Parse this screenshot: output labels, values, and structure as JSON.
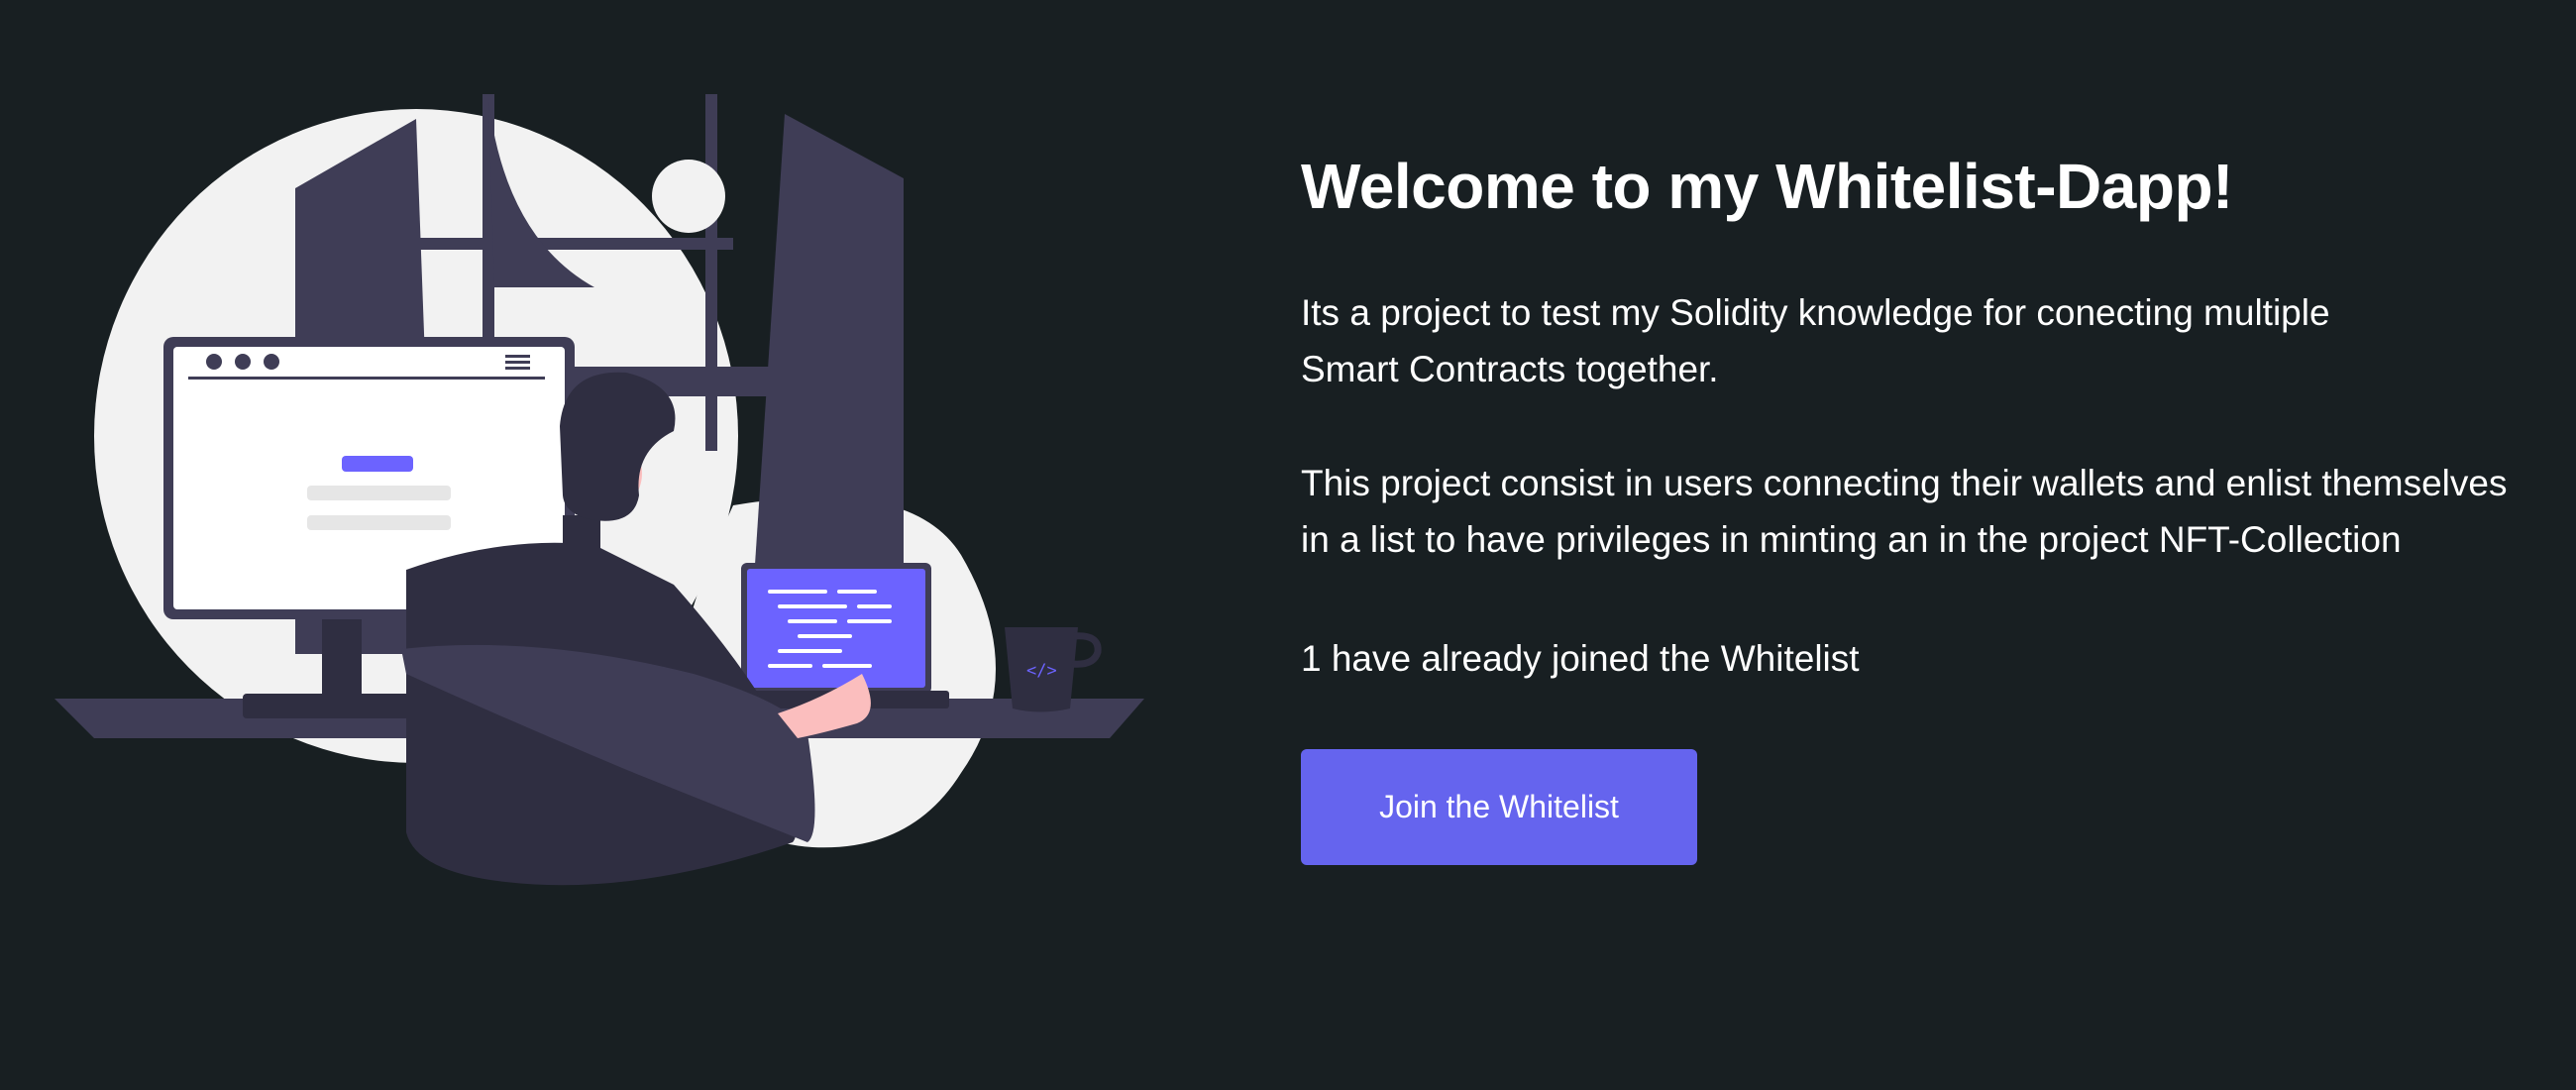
{
  "hero": {
    "title": "Welcome to my Whitelist-Dapp!",
    "description_1": "Its a project to test my Solidity knowledge for conecting multiple\nSmart Contracts together.",
    "description_2": "This project consist in users connecting their wallets and enlist themselves\nin a list to have privileges in minting an in the project NFT-Collection",
    "joined_count_text": "1 have already joined the Whitelist",
    "join_button_label": "Join the Whitelist"
  },
  "illustration": {
    "icon": "developer-at-desk-illustration",
    "accent_color": "#6c63ff",
    "background_color": "#181f22",
    "button_color": "#6564ee"
  }
}
